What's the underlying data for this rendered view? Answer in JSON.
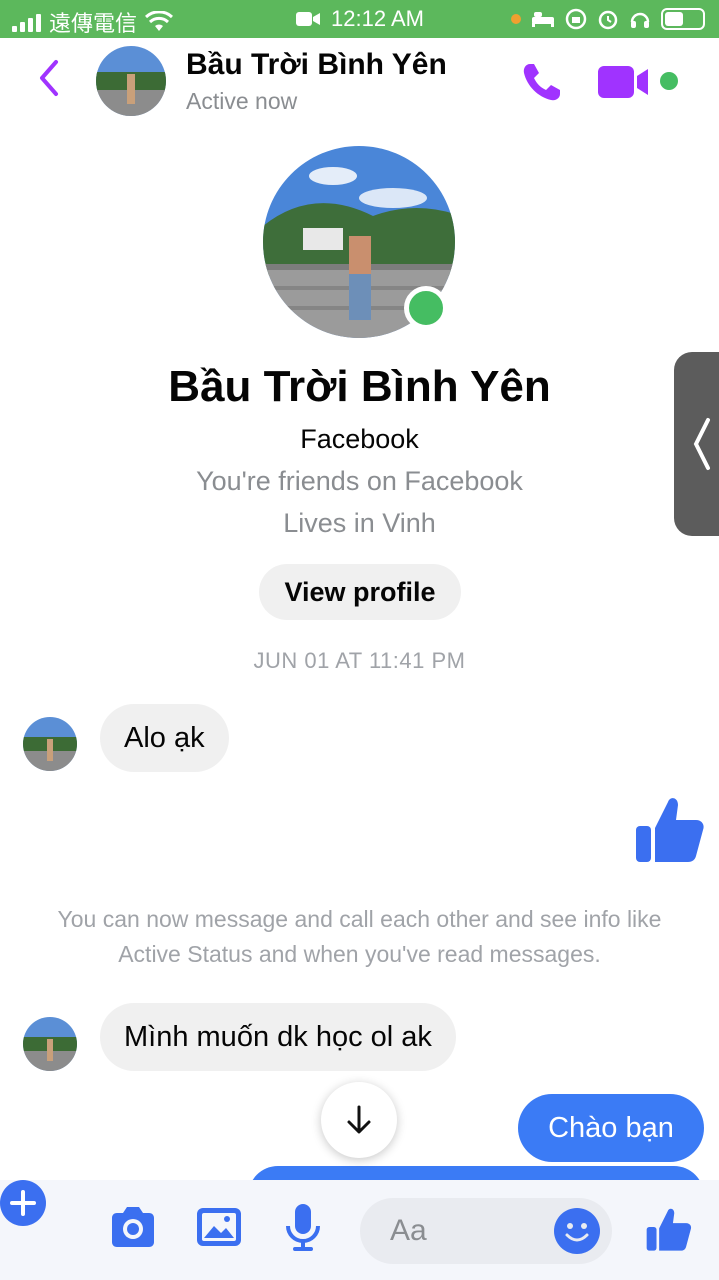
{
  "status_bar": {
    "carrier": "遠傳電信",
    "time": "12:12 AM"
  },
  "header": {
    "name": "Bầu Trời Bình Yên",
    "status": "Active now"
  },
  "profile": {
    "name": "Bầu Trời Bình Yên",
    "platform": "Facebook",
    "friends_note": "You're friends on Facebook",
    "lives": "Lives in Vinh",
    "view_profile_label": "View profile"
  },
  "timestamp": "JUN 01 AT 11:41 PM",
  "messages": {
    "incoming_1": "Alo ạk",
    "info": "You can now message and call each other and see info like Active Status and when you've read messages.",
    "incoming_2": "Mình muốn dk học ol ak",
    "outgoing_1": "Chào bạn"
  },
  "composer": {
    "placeholder": "Aa"
  },
  "colors": {
    "accent": "#3b6ff0",
    "messenger_purple": "#a033ff",
    "online_green": "#45bd62",
    "status_bar": "#5cb85c",
    "outgoing_bubble": "#3b7bf5"
  },
  "icons": [
    "back-icon",
    "phone-icon",
    "video-icon",
    "like-icon",
    "arrow-down-icon",
    "plus-icon",
    "camera-icon",
    "gallery-icon",
    "mic-icon",
    "emoji-icon"
  ]
}
